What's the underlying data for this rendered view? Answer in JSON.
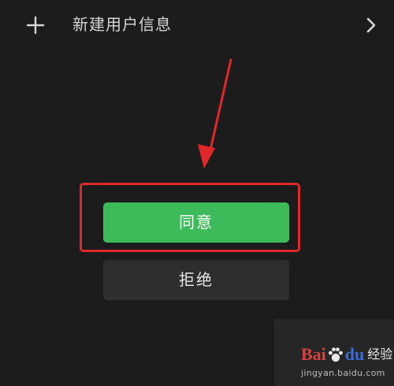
{
  "header": {
    "title": "新建用户信息"
  },
  "dialog": {
    "agree_label": "同意",
    "reject_label": "拒绝"
  },
  "watermark": {
    "bai": "Bai",
    "du": "du",
    "jingyan": "经验",
    "url": "jingyan.baidu.com"
  },
  "colors": {
    "background": "#1c1c1c",
    "agree_button": "#3dbb5a",
    "reject_button": "#2e2e2e",
    "annotation_red": "#e0282b"
  },
  "icons": {
    "left": "plus-icon",
    "right": "chevron-right-icon"
  }
}
